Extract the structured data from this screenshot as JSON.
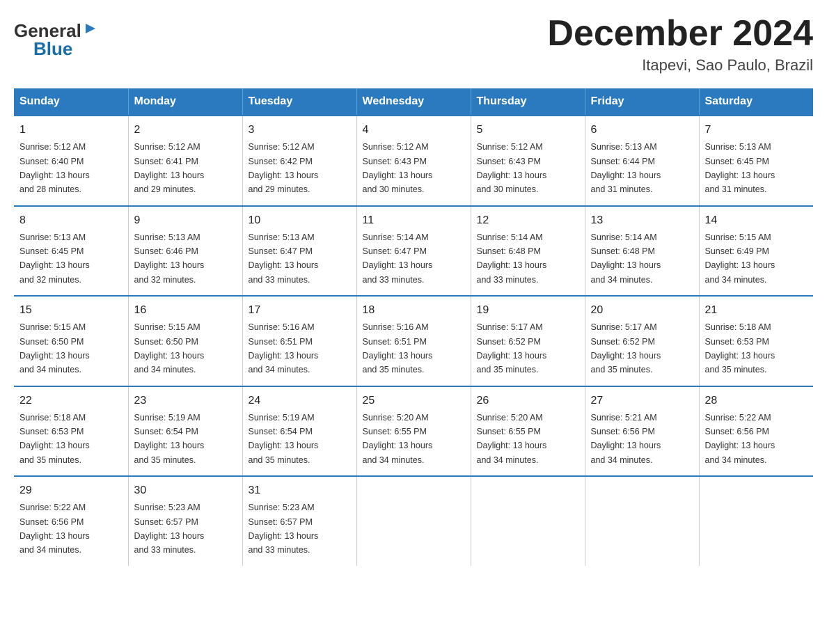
{
  "logo": {
    "general": "General",
    "triangle": "▶",
    "blue": "Blue"
  },
  "title": "December 2024",
  "subtitle": "Itapevi, Sao Paulo, Brazil",
  "days_of_week": [
    "Sunday",
    "Monday",
    "Tuesday",
    "Wednesday",
    "Thursday",
    "Friday",
    "Saturday"
  ],
  "weeks": [
    [
      {
        "day": "1",
        "sunrise": "5:12 AM",
        "sunset": "6:40 PM",
        "daylight": "13 hours and 28 minutes."
      },
      {
        "day": "2",
        "sunrise": "5:12 AM",
        "sunset": "6:41 PM",
        "daylight": "13 hours and 29 minutes."
      },
      {
        "day": "3",
        "sunrise": "5:12 AM",
        "sunset": "6:42 PM",
        "daylight": "13 hours and 29 minutes."
      },
      {
        "day": "4",
        "sunrise": "5:12 AM",
        "sunset": "6:43 PM",
        "daylight": "13 hours and 30 minutes."
      },
      {
        "day": "5",
        "sunrise": "5:12 AM",
        "sunset": "6:43 PM",
        "daylight": "13 hours and 30 minutes."
      },
      {
        "day": "6",
        "sunrise": "5:13 AM",
        "sunset": "6:44 PM",
        "daylight": "13 hours and 31 minutes."
      },
      {
        "day": "7",
        "sunrise": "5:13 AM",
        "sunset": "6:45 PM",
        "daylight": "13 hours and 31 minutes."
      }
    ],
    [
      {
        "day": "8",
        "sunrise": "5:13 AM",
        "sunset": "6:45 PM",
        "daylight": "13 hours and 32 minutes."
      },
      {
        "day": "9",
        "sunrise": "5:13 AM",
        "sunset": "6:46 PM",
        "daylight": "13 hours and 32 minutes."
      },
      {
        "day": "10",
        "sunrise": "5:13 AM",
        "sunset": "6:47 PM",
        "daylight": "13 hours and 33 minutes."
      },
      {
        "day": "11",
        "sunrise": "5:14 AM",
        "sunset": "6:47 PM",
        "daylight": "13 hours and 33 minutes."
      },
      {
        "day": "12",
        "sunrise": "5:14 AM",
        "sunset": "6:48 PM",
        "daylight": "13 hours and 33 minutes."
      },
      {
        "day": "13",
        "sunrise": "5:14 AM",
        "sunset": "6:48 PM",
        "daylight": "13 hours and 34 minutes."
      },
      {
        "day": "14",
        "sunrise": "5:15 AM",
        "sunset": "6:49 PM",
        "daylight": "13 hours and 34 minutes."
      }
    ],
    [
      {
        "day": "15",
        "sunrise": "5:15 AM",
        "sunset": "6:50 PM",
        "daylight": "13 hours and 34 minutes."
      },
      {
        "day": "16",
        "sunrise": "5:15 AM",
        "sunset": "6:50 PM",
        "daylight": "13 hours and 34 minutes."
      },
      {
        "day": "17",
        "sunrise": "5:16 AM",
        "sunset": "6:51 PM",
        "daylight": "13 hours and 34 minutes."
      },
      {
        "day": "18",
        "sunrise": "5:16 AM",
        "sunset": "6:51 PM",
        "daylight": "13 hours and 35 minutes."
      },
      {
        "day": "19",
        "sunrise": "5:17 AM",
        "sunset": "6:52 PM",
        "daylight": "13 hours and 35 minutes."
      },
      {
        "day": "20",
        "sunrise": "5:17 AM",
        "sunset": "6:52 PM",
        "daylight": "13 hours and 35 minutes."
      },
      {
        "day": "21",
        "sunrise": "5:18 AM",
        "sunset": "6:53 PM",
        "daylight": "13 hours and 35 minutes."
      }
    ],
    [
      {
        "day": "22",
        "sunrise": "5:18 AM",
        "sunset": "6:53 PM",
        "daylight": "13 hours and 35 minutes."
      },
      {
        "day": "23",
        "sunrise": "5:19 AM",
        "sunset": "6:54 PM",
        "daylight": "13 hours and 35 minutes."
      },
      {
        "day": "24",
        "sunrise": "5:19 AM",
        "sunset": "6:54 PM",
        "daylight": "13 hours and 35 minutes."
      },
      {
        "day": "25",
        "sunrise": "5:20 AM",
        "sunset": "6:55 PM",
        "daylight": "13 hours and 34 minutes."
      },
      {
        "day": "26",
        "sunrise": "5:20 AM",
        "sunset": "6:55 PM",
        "daylight": "13 hours and 34 minutes."
      },
      {
        "day": "27",
        "sunrise": "5:21 AM",
        "sunset": "6:56 PM",
        "daylight": "13 hours and 34 minutes."
      },
      {
        "day": "28",
        "sunrise": "5:22 AM",
        "sunset": "6:56 PM",
        "daylight": "13 hours and 34 minutes."
      }
    ],
    [
      {
        "day": "29",
        "sunrise": "5:22 AM",
        "sunset": "6:56 PM",
        "daylight": "13 hours and 34 minutes."
      },
      {
        "day": "30",
        "sunrise": "5:23 AM",
        "sunset": "6:57 PM",
        "daylight": "13 hours and 33 minutes."
      },
      {
        "day": "31",
        "sunrise": "5:23 AM",
        "sunset": "6:57 PM",
        "daylight": "13 hours and 33 minutes."
      },
      null,
      null,
      null,
      null
    ]
  ],
  "labels": {
    "sunrise": "Sunrise:",
    "sunset": "Sunset:",
    "daylight": "Daylight:"
  }
}
